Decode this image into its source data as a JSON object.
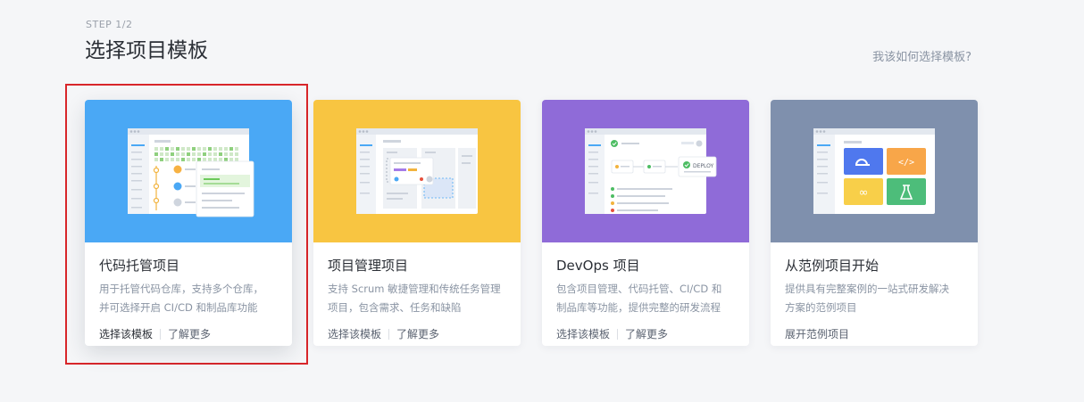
{
  "header": {
    "step": "STEP 1/2",
    "title": "选择项目模板",
    "help_link": "我该如何选择模板?"
  },
  "colors": {
    "code_hosting": "#4aa8f5",
    "project_management": "#f8c541",
    "devops": "#8f6bd8",
    "examples": "#7f90ad",
    "selection_frame": "#d8262a"
  },
  "cards": [
    {
      "title": "代码托管项目",
      "desc_line1": "用于托管代码仓库，支持多个仓库，",
      "desc_line2": "并可选择开启 CI/CD 和制品库功能",
      "action_primary": "选择该模板",
      "action_secondary": "了解更多"
    },
    {
      "title": "项目管理项目",
      "desc_line1": "支持 Scrum 敏捷管理和传统任务管理",
      "desc_line2": "项目，包含需求、任务和缺陷",
      "action_primary": "选择该模板",
      "action_secondary": "了解更多"
    },
    {
      "title": "DevOps 项目",
      "desc_line1": "包含项目管理、代码托管、CI/CD 和",
      "desc_line2": "制品库等功能，提供完整的研发流程",
      "action_primary": "选择该模板",
      "action_secondary": "了解更多",
      "deploy_label": "DEPLOY"
    },
    {
      "title": "从范例项目开始",
      "desc_line1": "提供具有完整案例的一站式研发解决",
      "desc_line2": "方案的范例项目",
      "action_primary": "展开范例项目"
    }
  ]
}
